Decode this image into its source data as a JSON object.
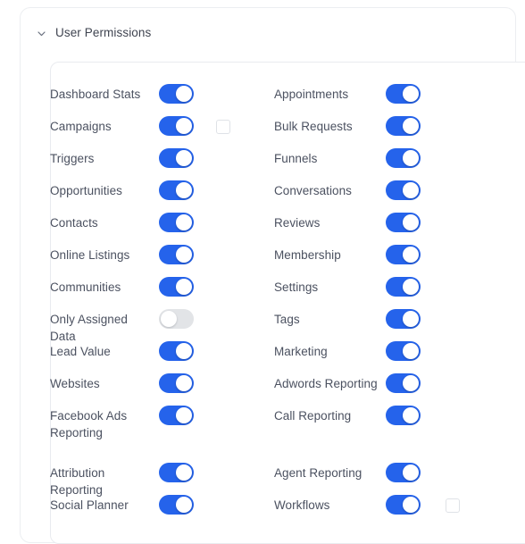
{
  "section": {
    "title": "User Permissions",
    "collapse_icon": "chevron-down-icon",
    "expanded": true
  },
  "colors": {
    "toggle_on": "#2563eb",
    "toggle_off": "#e2e4e7",
    "knob": "#ffffff",
    "label_text": "#4b5160",
    "title_text": "#3f4450",
    "card_border": "#e9ebef",
    "panel_border": "#eceef1",
    "checkbox_border": "#dfe2e7",
    "background": "#ffffff"
  },
  "permissions": {
    "left_column": [
      {
        "label": "Dashboard Stats",
        "enabled": true,
        "checkbox": false,
        "wraps": false
      },
      {
        "label": "Campaigns",
        "enabled": true,
        "checkbox": true,
        "checked": false,
        "wraps": false
      },
      {
        "label": "Triggers",
        "enabled": true,
        "checkbox": false,
        "wraps": false
      },
      {
        "label": "Opportunities",
        "enabled": true,
        "checkbox": false,
        "wraps": false
      },
      {
        "label": "Contacts",
        "enabled": true,
        "checkbox": false,
        "wraps": false
      },
      {
        "label": "Online Listings",
        "enabled": true,
        "checkbox": false,
        "wraps": false
      },
      {
        "label": "Communities",
        "enabled": true,
        "checkbox": false,
        "wraps": false
      },
      {
        "label": "Only Assigned Data",
        "enabled": false,
        "checkbox": false,
        "wraps": false
      },
      {
        "label": "Lead Value",
        "enabled": true,
        "checkbox": false,
        "wraps": false
      },
      {
        "label": "Websites",
        "enabled": true,
        "checkbox": false,
        "wraps": false
      },
      {
        "label": "Facebook Ads Reporting",
        "enabled": true,
        "checkbox": false,
        "wraps": true
      },
      {
        "label": "Attribution Reporting",
        "enabled": true,
        "checkbox": false,
        "wraps": false
      },
      {
        "label": "Social Planner",
        "enabled": true,
        "checkbox": false,
        "wraps": false
      }
    ],
    "right_column": [
      {
        "label": "Appointments",
        "enabled": true,
        "checkbox": false,
        "wraps": false
      },
      {
        "label": "Bulk Requests",
        "enabled": true,
        "checkbox": false,
        "wraps": false
      },
      {
        "label": "Funnels",
        "enabled": true,
        "checkbox": false,
        "wraps": false
      },
      {
        "label": "Conversations",
        "enabled": true,
        "checkbox": false,
        "wraps": false
      },
      {
        "label": "Reviews",
        "enabled": true,
        "checkbox": false,
        "wraps": false
      },
      {
        "label": "Membership",
        "enabled": true,
        "checkbox": false,
        "wraps": false
      },
      {
        "label": "Settings",
        "enabled": true,
        "checkbox": false,
        "wraps": false
      },
      {
        "label": "Tags",
        "enabled": true,
        "checkbox": false,
        "wraps": false
      },
      {
        "label": "Marketing",
        "enabled": true,
        "checkbox": false,
        "wraps": false
      },
      {
        "label": "Adwords Reporting",
        "enabled": true,
        "checkbox": false,
        "wraps": false
      },
      {
        "label": "Call Reporting",
        "enabled": true,
        "checkbox": false,
        "wraps": true
      },
      {
        "label": "Agent Reporting",
        "enabled": true,
        "checkbox": false,
        "wraps": false
      },
      {
        "label": "Workflows",
        "enabled": true,
        "checkbox": true,
        "checked": false,
        "wraps": false
      }
    ]
  }
}
